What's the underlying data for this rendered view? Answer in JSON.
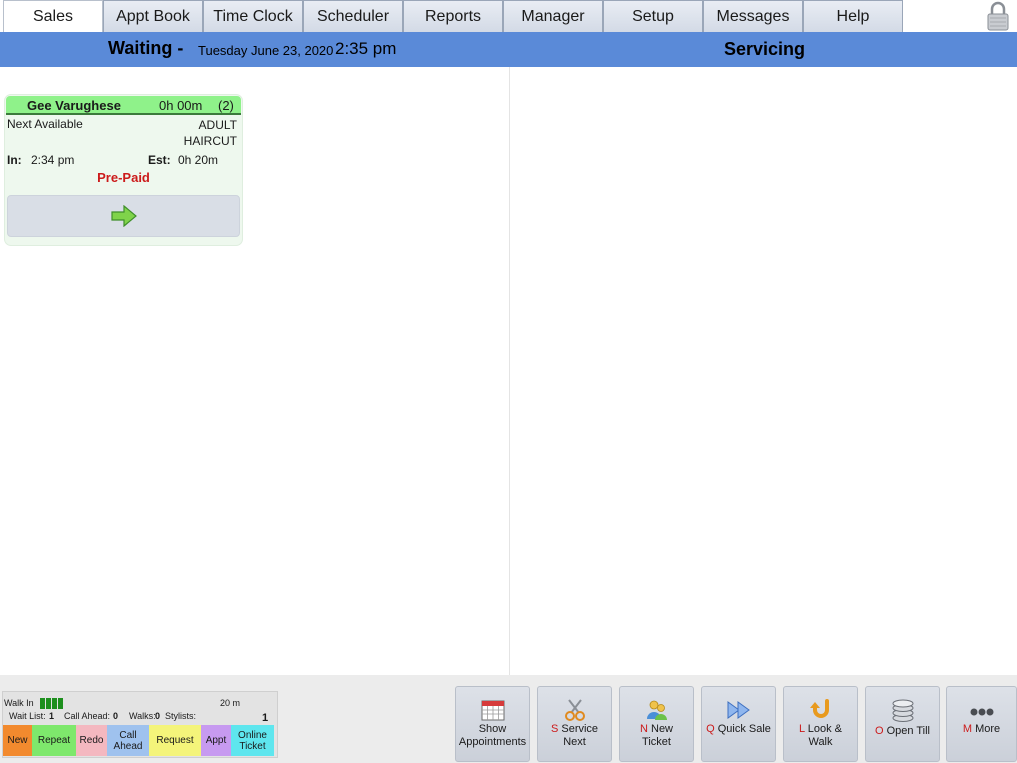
{
  "menu": {
    "tabs": [
      "Sales",
      "Appt Book",
      "Time Clock",
      "Scheduler",
      "Reports",
      "Manager",
      "Setup",
      "Messages",
      "Help"
    ],
    "active_tab": "Sales"
  },
  "header": {
    "waiting_title": "Waiting -",
    "date": "Tuesday June 23, 2020",
    "time": "2:35 pm",
    "servicing_title": "Servicing"
  },
  "ticket": {
    "name": "Gee Varughese",
    "duration": "0h 00m",
    "count": "(2)",
    "stylist": "Next Available",
    "service_line1": "ADULT",
    "service_line2": "HAIRCUT",
    "in_label": "In:",
    "in_time": "2:34 pm",
    "est_label": "Est:",
    "est_time": "0h 20m",
    "status": "Pre-Paid",
    "header_color": "#8ff28a",
    "status_color": "#cc1a1a"
  },
  "legend": {
    "walk_in_label": "Walk In",
    "walk_in_time": "20 m",
    "wait_list_label": "Wait List:",
    "wait_list_value": "1",
    "call_ahead_label": "Call Ahead:",
    "call_ahead_value": "0",
    "walks_label": "Walks:",
    "walks_value": "0",
    "stylists_label": "Stylists:",
    "stylists_value": "1",
    "tags": [
      {
        "label": "New",
        "color": "#f28a2e"
      },
      {
        "label": "Repeat",
        "color": "#7ee86c"
      },
      {
        "label": "Redo",
        "color": "#f4b8c0"
      },
      {
        "label": "Call Ahead",
        "color": "#9fc2ee"
      },
      {
        "label": "Request",
        "color": "#f4f47a"
      },
      {
        "label": "Appt",
        "color": "#c79af0"
      },
      {
        "label": "Online Ticket",
        "color": "#5ee6ee"
      }
    ]
  },
  "actions": [
    {
      "hotkey": "",
      "label_line1": "Show",
      "label_line2": "Appointments",
      "icon": "calendar-icon"
    },
    {
      "hotkey": "S",
      "label_line1": "Service",
      "label_line2": "Next",
      "icon": "scissors-icon"
    },
    {
      "hotkey": "N",
      "label_line1": "New",
      "label_line2": "Ticket",
      "icon": "people-icon"
    },
    {
      "hotkey": "Q",
      "label_line1": "Quick Sale",
      "label_line2": "",
      "icon": "fast-forward-icon"
    },
    {
      "hotkey": "L",
      "label_line1": "Look &",
      "label_line2": "Walk",
      "icon": "u-turn-icon"
    },
    {
      "hotkey": "O",
      "label_line1": "Open Till",
      "label_line2": "",
      "icon": "coins-icon"
    },
    {
      "hotkey": "M",
      "label_line1": "More",
      "label_line2": "",
      "icon": "more-dots-icon"
    }
  ]
}
